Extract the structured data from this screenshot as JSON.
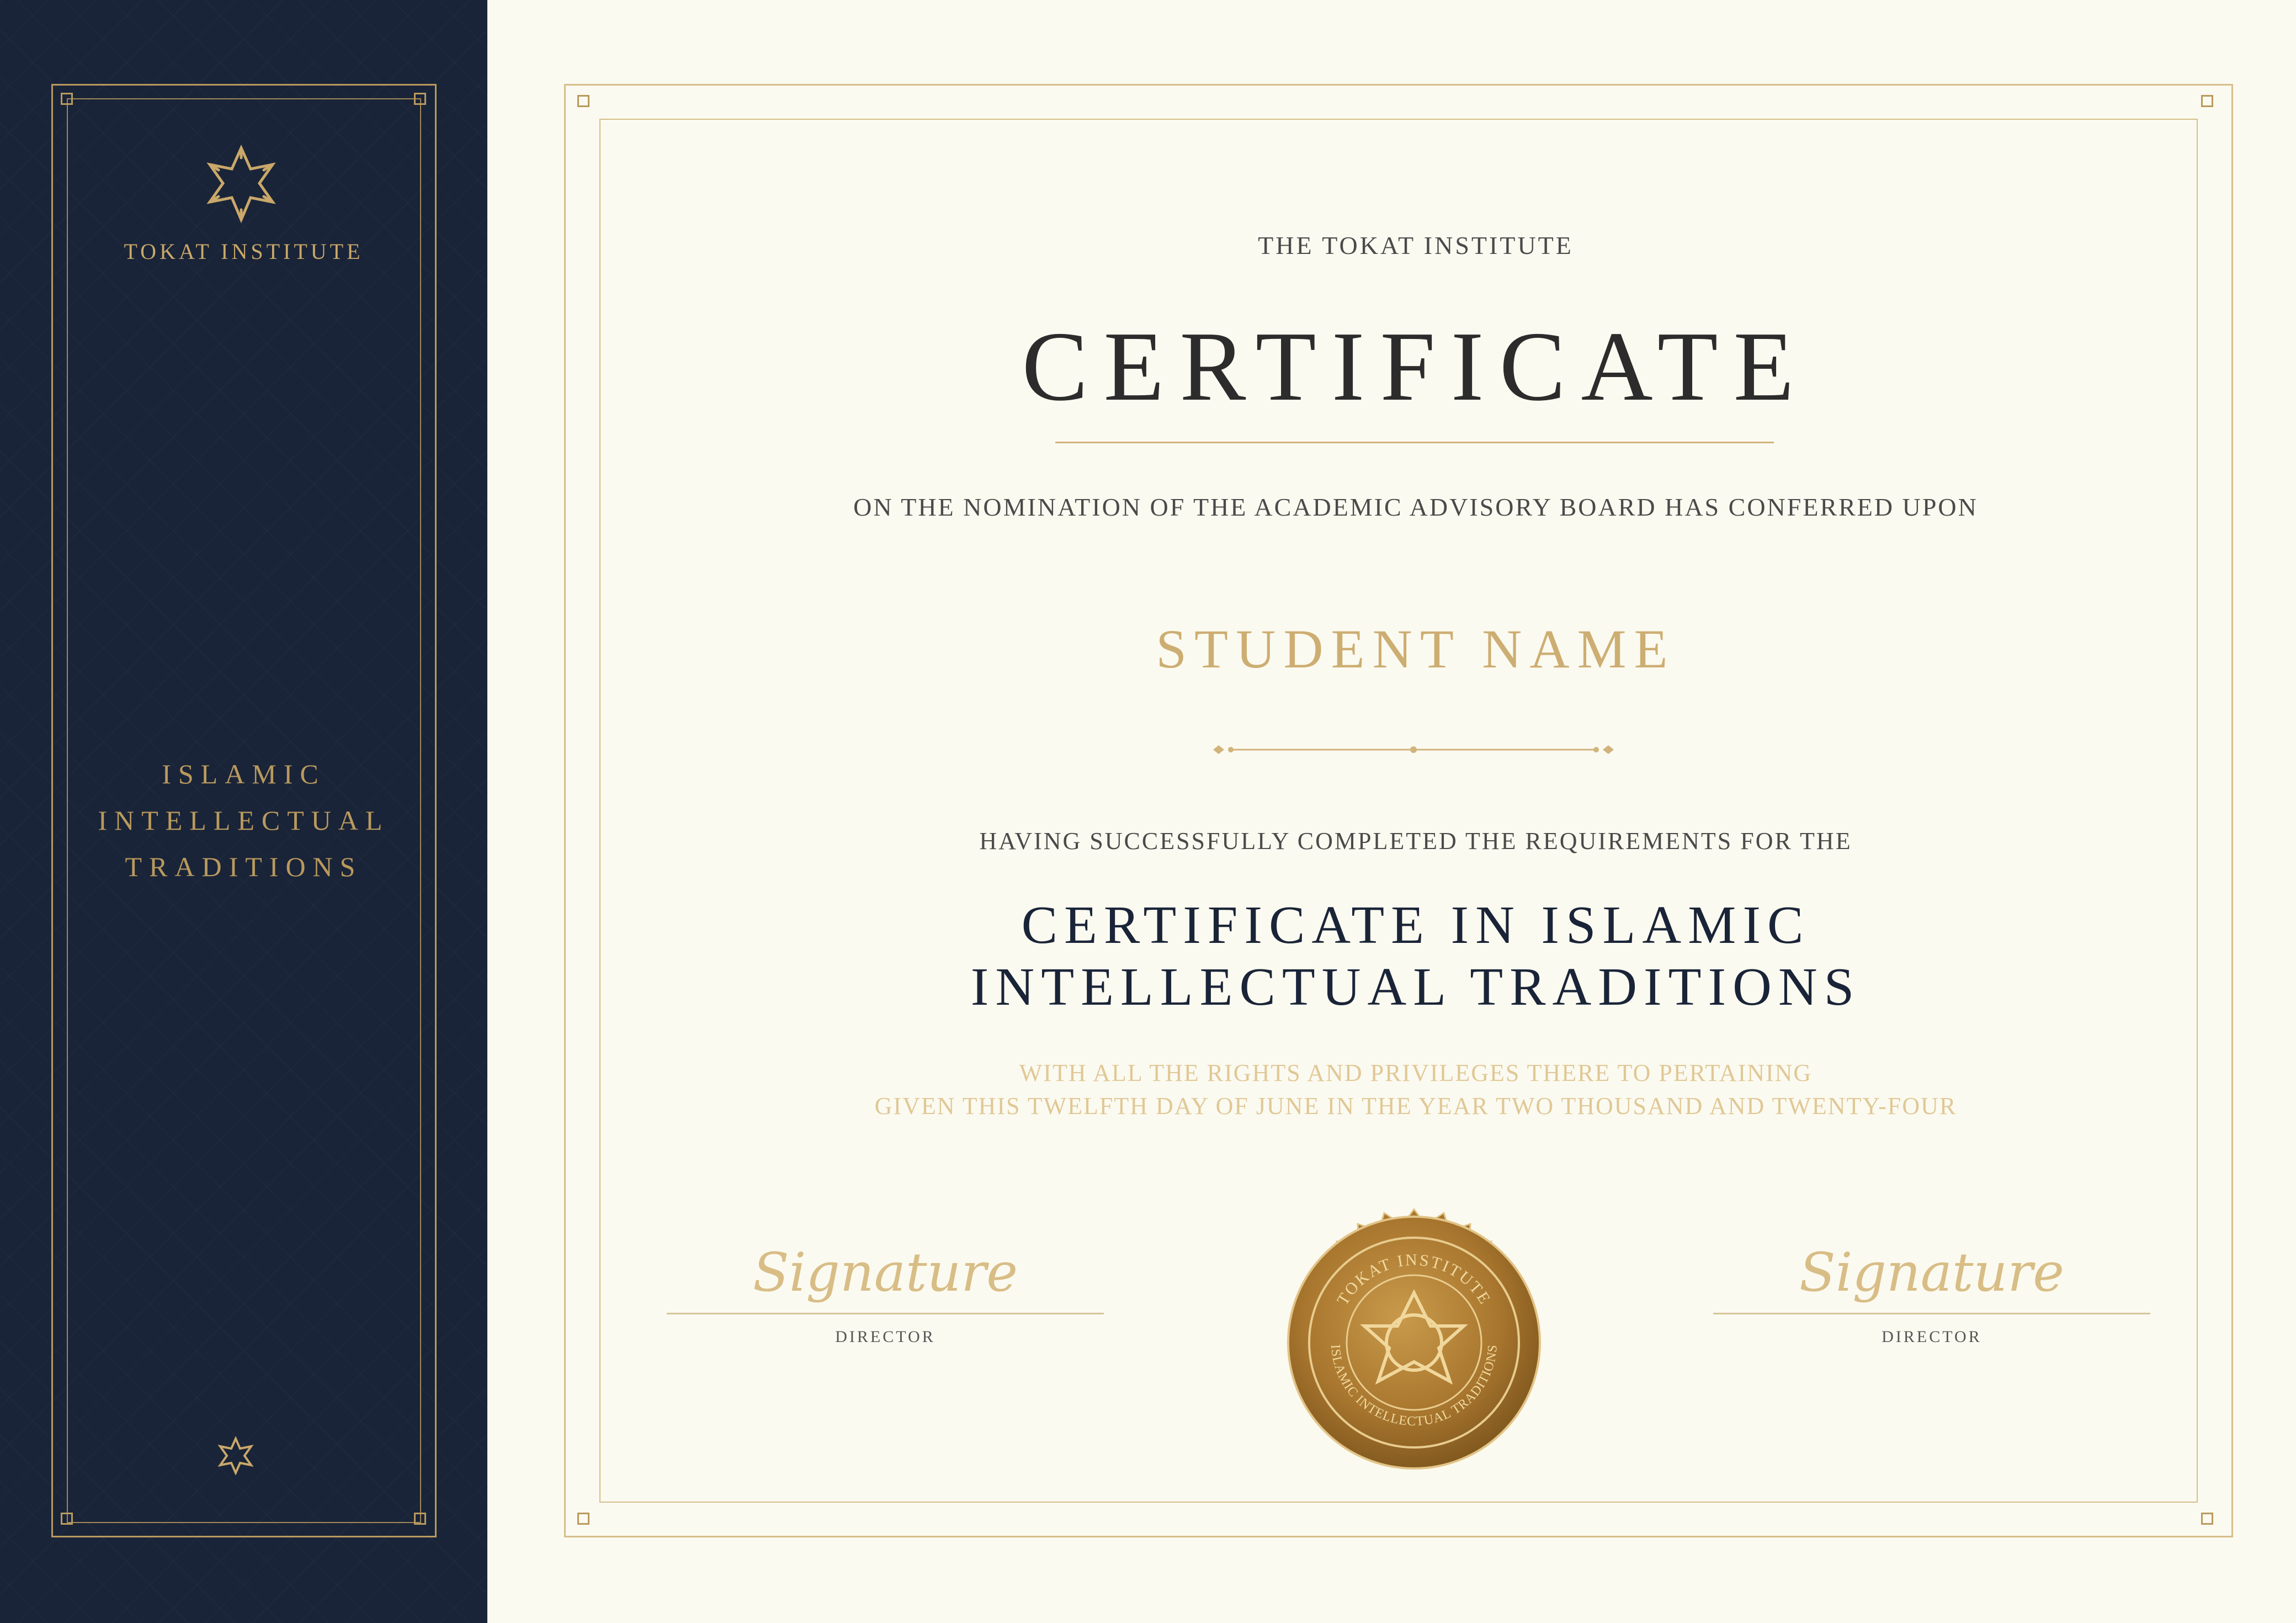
{
  "sidebar": {
    "brand": "TOKAT INSTITUTE",
    "program_lines": [
      "ISLAMIC",
      "INTELLECTUAL",
      "TRADITIONS"
    ],
    "logo_icon": "geometric-star-icon",
    "footer_icon": "small-star-icon"
  },
  "certificate": {
    "institute_line": "THE TOKAT INSTITUTE",
    "title": "CERTIFICATE",
    "nomination": "ON THE NOMINATION OF THE ACADEMIC ADVISORY BOARD HAS CONFERRED UPON",
    "student_name": "STUDENT NAME",
    "completed_line": "HAVING SUCCESSFULLY COMPLETED THE REQUIREMENTS FOR THE",
    "program_lines": [
      "CERTIFICATE IN ISLAMIC",
      "INTELLECTUAL TRADITIONS"
    ],
    "rights_lines": [
      "WITH ALL THE RIGHTS AND PRIVILEGES THERE TO PERTAINING",
      "GIVEN THIS TWELFTH DAY OF JUNE IN THE YEAR TWO THOUSAND AND TWENTY-FOUR"
    ]
  },
  "signatures": {
    "left": {
      "script": "Signature",
      "role": "DIRECTOR"
    },
    "right": {
      "script": "Signature",
      "role": "DIRECTOR"
    }
  },
  "seal": {
    "top_text": "TOKAT INSTITUTE",
    "bottom_text": "ISLAMIC INTELLECTUAL TRADITIONS",
    "icon": "seal-star-icon"
  },
  "colors": {
    "navy": "#1a2438",
    "gold": "#c9a86a",
    "paper": "#fbfaf0"
  }
}
